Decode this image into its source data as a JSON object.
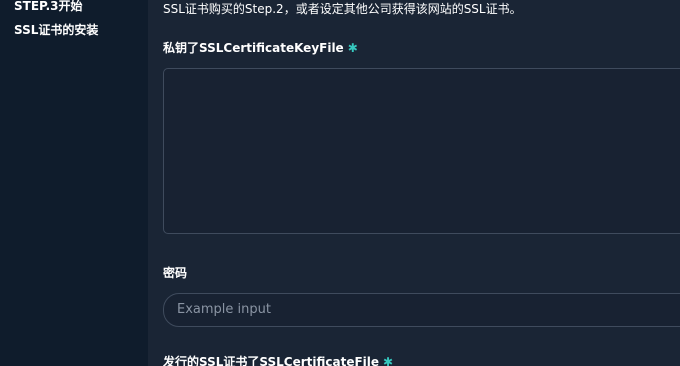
{
  "sidebar": {
    "items": [
      {
        "label": "STEP.3开始"
      },
      {
        "label": "SSL证书的安装"
      }
    ]
  },
  "form": {
    "description": "SSL证书购买的Step.2，或者设定其他公司获得该网站的SSL证书。",
    "key_label": "私钥了SSLCertificateKeyFile",
    "key_value": "",
    "password_label": "密码",
    "password_placeholder": "Example input",
    "cert_label": "发行的SSL证书了SSLCertificateFile",
    "required_mark": "✱"
  },
  "colors": {
    "accent": "#36c9c0",
    "panel_bg": "#1a2535",
    "sidebar_bg": "#0f1c2c",
    "border": "#3f4b5d"
  }
}
